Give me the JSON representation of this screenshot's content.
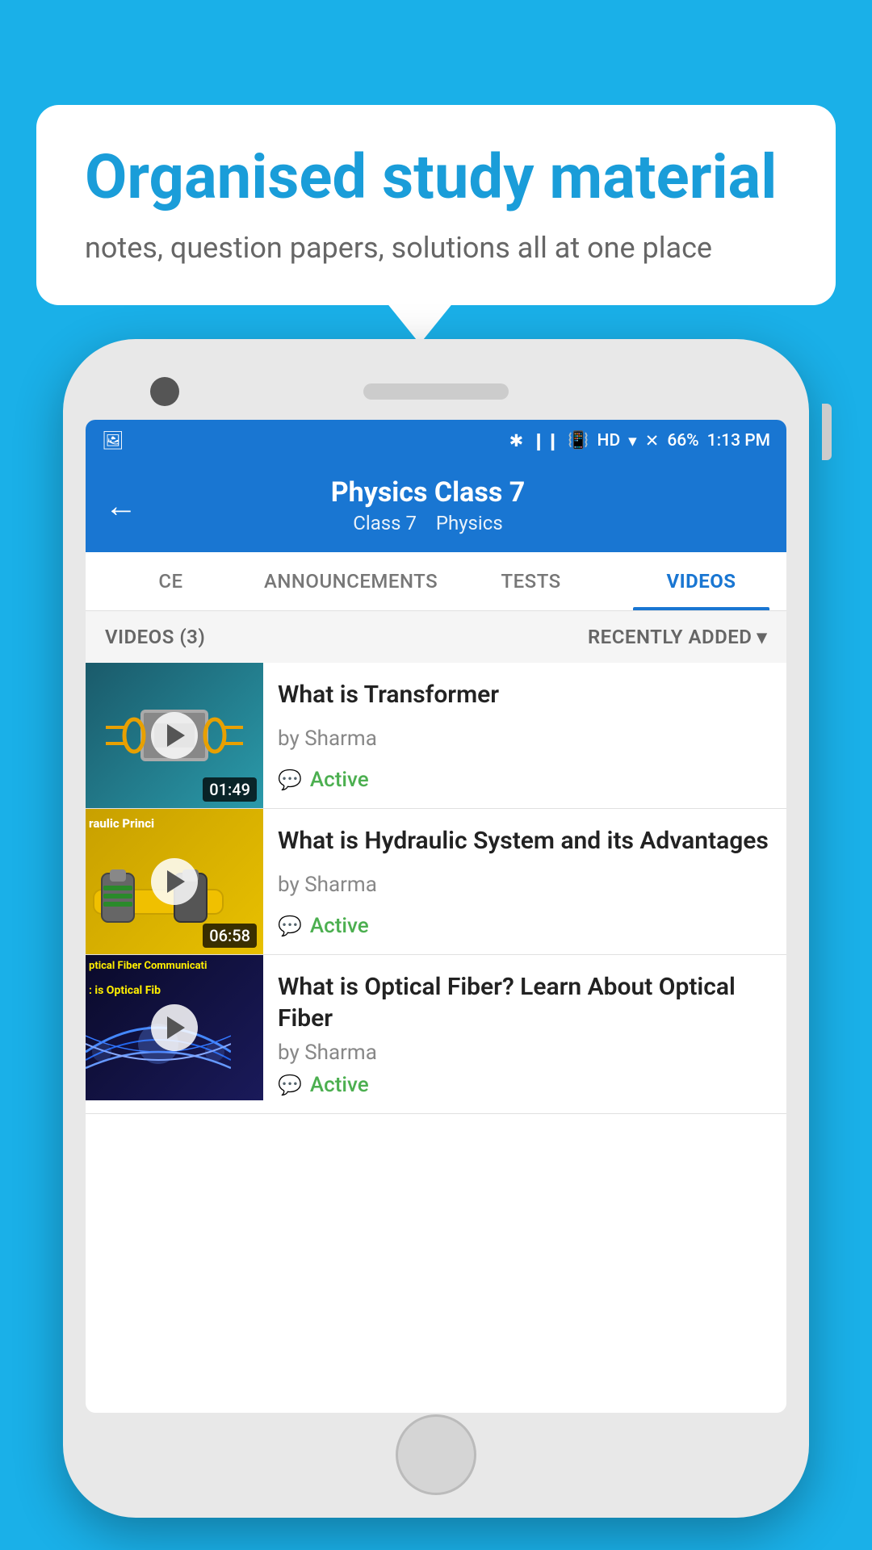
{
  "background_color": "#1ab0e8",
  "speech_bubble": {
    "heading": "Organised study material",
    "subtext": "notes, question papers, solutions all at one place"
  },
  "status_bar": {
    "time": "1:13 PM",
    "battery": "66%",
    "signal_icons": "▶ ❙❙ HD ▾ ✕❙"
  },
  "app_header": {
    "title": "Physics Class 7",
    "breadcrumb_class": "Class 7",
    "breadcrumb_subject": "Physics",
    "back_label": "←"
  },
  "tabs": [
    {
      "id": "ce",
      "label": "CE",
      "active": false
    },
    {
      "id": "announcements",
      "label": "ANNOUNCEMENTS",
      "active": false
    },
    {
      "id": "tests",
      "label": "TESTS",
      "active": false
    },
    {
      "id": "videos",
      "label": "VIDEOS",
      "active": true
    }
  ],
  "videos_header": {
    "count_label": "VIDEOS (3)",
    "sort_label": "RECENTLY ADDED",
    "sort_icon": "▾"
  },
  "videos": [
    {
      "title": "What is  Transformer",
      "author": "by Sharma",
      "status": "Active",
      "duration": "01:49",
      "thumbnail_type": "transformer"
    },
    {
      "title": "What is Hydraulic System and its Advantages",
      "author": "by Sharma",
      "status": "Active",
      "duration": "06:58",
      "thumbnail_type": "hydraulic",
      "thumbnail_text": "raulic Princi"
    },
    {
      "title": "What is Optical Fiber? Learn About Optical Fiber",
      "author": "by Sharma",
      "status": "Active",
      "duration": "",
      "thumbnail_type": "optical",
      "thumbnail_text1": "ptical Fiber Communicati",
      "thumbnail_text2": ": is Optical Fib"
    }
  ]
}
